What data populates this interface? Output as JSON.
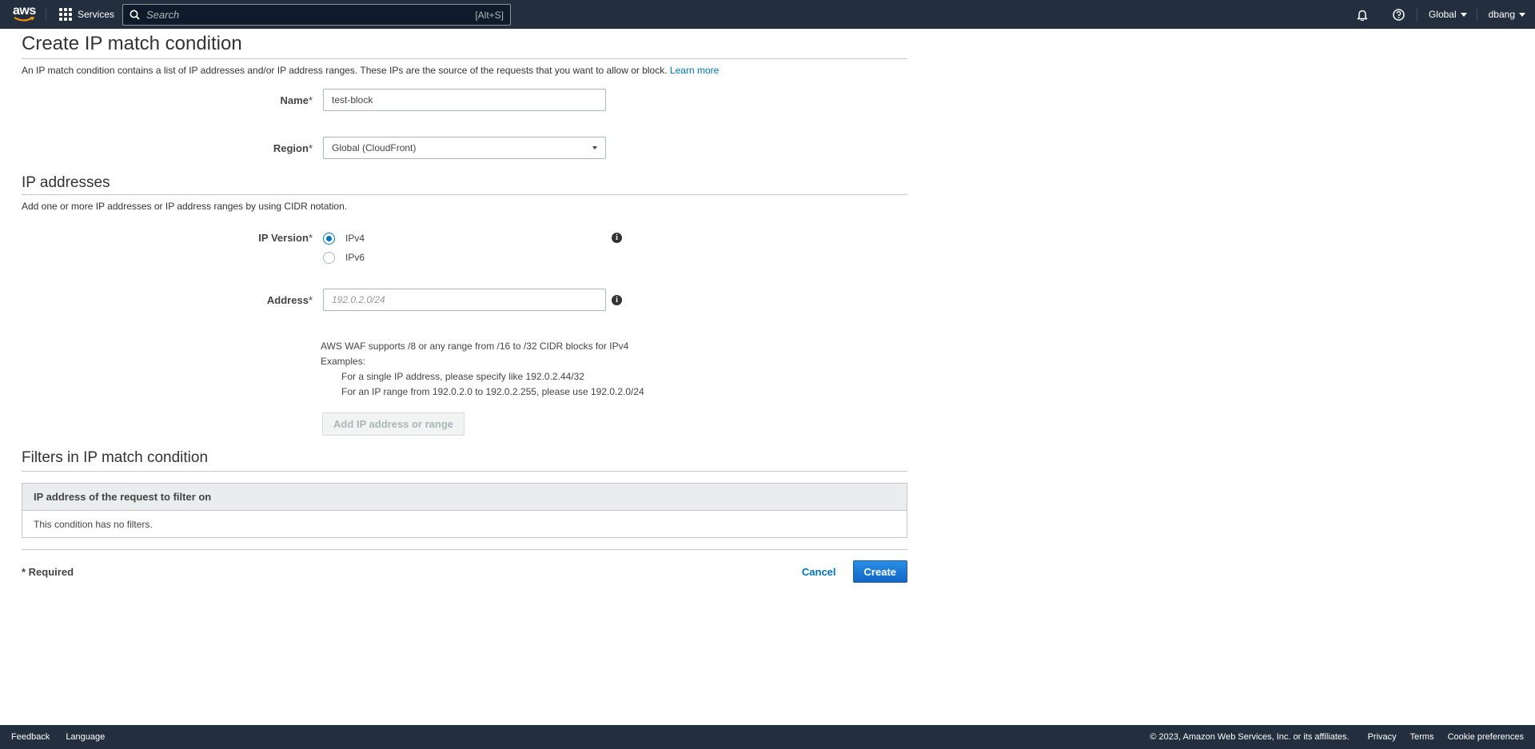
{
  "topnav": {
    "logo_text": "aws",
    "services_label": "Services",
    "search_placeholder": "Search",
    "search_shortcut": "[Alt+S]",
    "region_label": "Global",
    "user_label": "dbang"
  },
  "page": {
    "title": "Create IP match condition",
    "description": "An IP match condition contains a list of IP addresses and/or IP address ranges. These IPs are the source of the requests that you want to allow or block.",
    "learn_more": "Learn more",
    "name_label": "Name",
    "name_value": "test-block",
    "region_label": "Region",
    "region_value": "Global (CloudFront)",
    "required_mark": "*"
  },
  "ip_addresses": {
    "heading": "IP addresses",
    "description": "Add one or more IP addresses or IP address ranges by using CIDR notation.",
    "version_label": "IP Version",
    "options": [
      "IPv4",
      "IPv6"
    ],
    "selected": "IPv4",
    "address_label": "Address",
    "address_placeholder": "192.0.2.0/24",
    "help_line1": "AWS WAF supports /8 or any range from /16 to /32 CIDR blocks for IPv4",
    "help_line2": "Examples:",
    "help_line3": "For a single IP address, please specify like 192.0.2.44/32",
    "help_line4": "For an IP range from 192.0.2.0 to 192.0.2.255, please use 192.0.2.0/24",
    "add_button": "Add IP address or range"
  },
  "filters": {
    "heading": "Filters in IP match condition",
    "column_header": "IP address of the request to filter on",
    "empty_text": "This condition has no filters."
  },
  "footer_actions": {
    "required_note": "* Required",
    "cancel": "Cancel",
    "create": "Create"
  },
  "bottombar": {
    "feedback": "Feedback",
    "language": "Language",
    "copyright": "© 2023, Amazon Web Services, Inc. or its affiliates.",
    "privacy": "Privacy",
    "terms": "Terms",
    "cookies": "Cookie preferences"
  },
  "colors": {
    "nav_bg": "#232f3e",
    "link": "#0073bb",
    "primary": "#1366c7"
  }
}
